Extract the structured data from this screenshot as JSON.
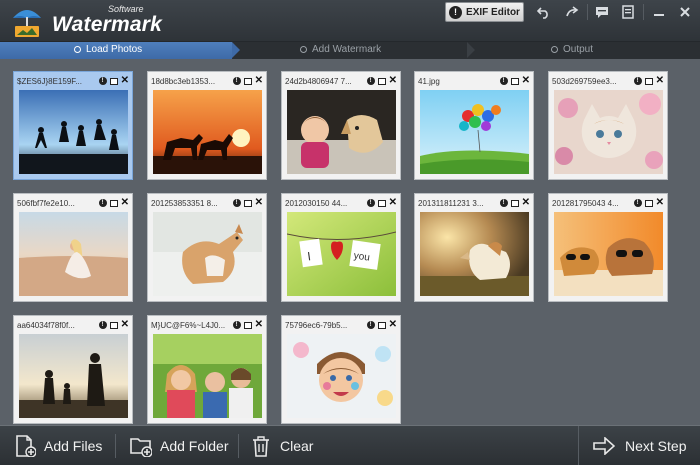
{
  "app": {
    "brand_small": "Software",
    "brand": "Watermark",
    "exif_label": "EXIF Editor"
  },
  "titlebar_icons": [
    "undo-icon",
    "redo-icon",
    "chat-icon",
    "notes-icon",
    "minimize-icon",
    "close-icon"
  ],
  "steps": [
    {
      "label": "Load Photos",
      "active": true
    },
    {
      "label": "Add Watermark",
      "active": false
    },
    {
      "label": "Output",
      "active": false
    }
  ],
  "photos": [
    {
      "name": "$ZES6J}8E159F...",
      "scene": "silhouettes-jump",
      "selected": true
    },
    {
      "name": "18d8bc3eb1353...",
      "scene": "horses-sunset",
      "selected": false
    },
    {
      "name": "24d2b4806947 7...",
      "scene": "baby-dog",
      "selected": false
    },
    {
      "name": "41.jpg",
      "scene": "balloons",
      "selected": false
    },
    {
      "name": "503d269759ee3...",
      "scene": "kitten-flowers",
      "selected": false
    },
    {
      "name": "506fbf7fe2e10...",
      "scene": "beach-girl",
      "selected": false
    },
    {
      "name": "201253853351 8...",
      "scene": "cat-jumping",
      "selected": false
    },
    {
      "name": "2012030150 44...",
      "scene": "hearts-line",
      "selected": false
    },
    {
      "name": "201311811231 3...",
      "scene": "dog-sunset",
      "selected": false
    },
    {
      "name": "201281795043 4...",
      "scene": "dogs-sunglasses",
      "selected": false
    },
    {
      "name": "aa64034f78f0f...",
      "scene": "family-silhouette",
      "selected": false
    },
    {
      "name": "M}UC@F6%~L4J0...",
      "scene": "kids-outdoors",
      "selected": false
    },
    {
      "name": "75796ec6-79b5...",
      "scene": "girl-facepaint",
      "selected": false
    }
  ],
  "bottom": {
    "add_files": "Add Files",
    "add_folder": "Add Folder",
    "clear": "Clear",
    "next_step": "Next Step"
  }
}
